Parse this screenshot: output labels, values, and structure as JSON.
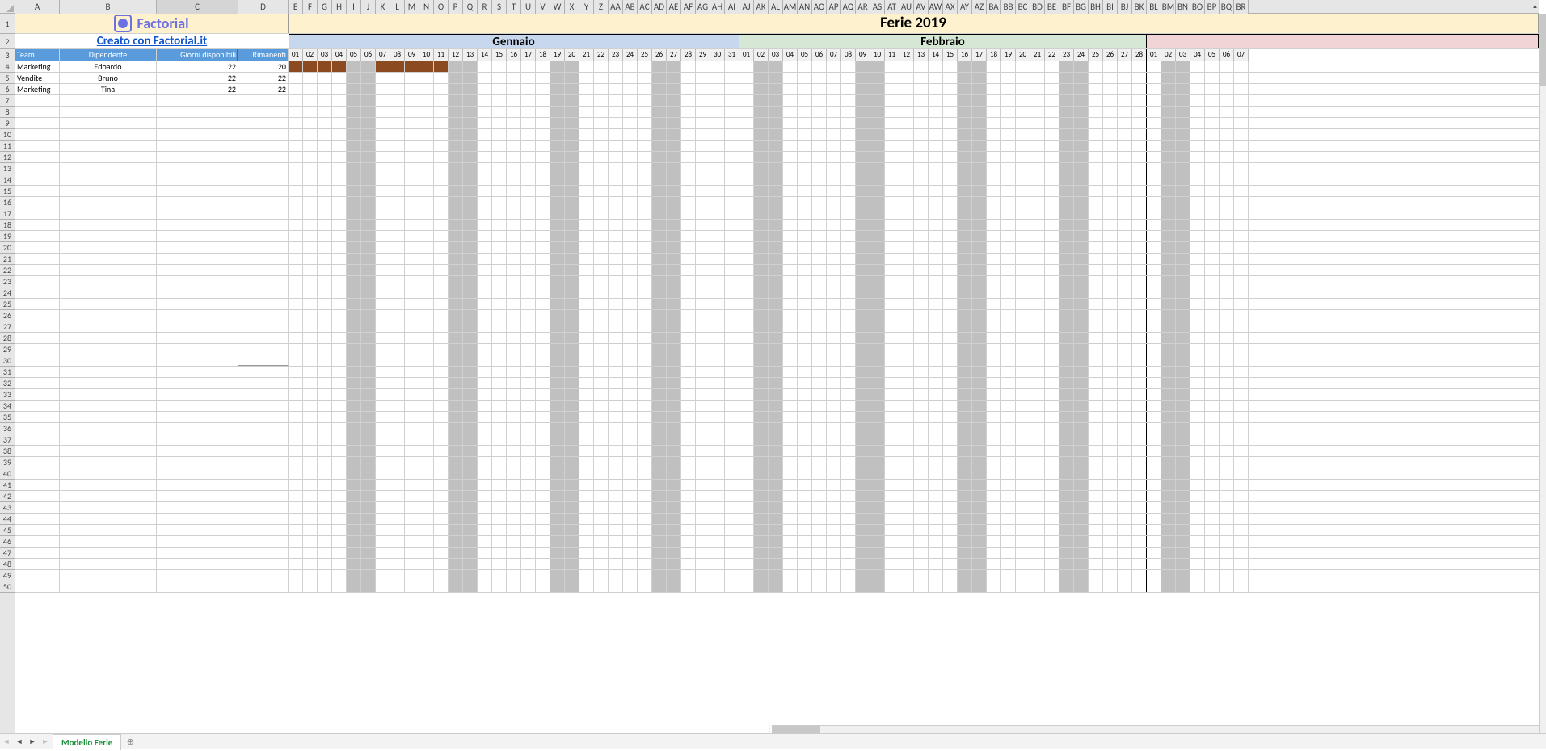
{
  "title": "Ferie 2019",
  "logo_text": "Factorial",
  "link_text": "Creato con Factorial.it",
  "months": {
    "jan": "Gennaio",
    "feb": "Febbraio"
  },
  "headers": {
    "team": "Team",
    "dip": "Dipendente",
    "disp": "Giorni disponibili",
    "rim": "Rimanenti"
  },
  "employees": [
    {
      "team": "Marketing",
      "name": "Edoardo",
      "disp": "22",
      "rim": "20"
    },
    {
      "team": "Vendite",
      "name": "Bruno",
      "disp": "22",
      "rim": "22"
    },
    {
      "team": "Marketing",
      "name": "Tina",
      "disp": "22",
      "rim": "22"
    }
  ],
  "columns": [
    "A",
    "B",
    "C",
    "D",
    "E",
    "F",
    "G",
    "H",
    "I",
    "J",
    "K",
    "L",
    "M",
    "N",
    "O",
    "P",
    "Q",
    "R",
    "S",
    "T",
    "U",
    "V",
    "W",
    "X",
    "Y",
    "Z",
    "AA",
    "AB",
    "AC",
    "AD",
    "AE",
    "AF",
    "AG",
    "AH",
    "AI",
    "AJ",
    "AK",
    "AL",
    "AM",
    "AN",
    "AO",
    "AP",
    "AQ",
    "AR",
    "AS",
    "AT",
    "AU",
    "AV",
    "AW",
    "AX",
    "AY",
    "AZ",
    "BA",
    "BB",
    "BC",
    "BD",
    "BE",
    "BF",
    "BG",
    "BH",
    "BI",
    "BJ",
    "BK",
    "BL",
    "BM",
    "BN",
    "BO",
    "BP",
    "BQ",
    "BR"
  ],
  "jan_days": [
    "01",
    "02",
    "03",
    "04",
    "05",
    "06",
    "07",
    "08",
    "09",
    "10",
    "11",
    "12",
    "13",
    "14",
    "15",
    "16",
    "17",
    "18",
    "19",
    "20",
    "21",
    "22",
    "23",
    "24",
    "25",
    "26",
    "27",
    "28",
    "29",
    "30",
    "31"
  ],
  "feb_days": [
    "01",
    "02",
    "03",
    "04",
    "05",
    "06",
    "07",
    "08",
    "09",
    "10",
    "11",
    "12",
    "13",
    "14",
    "15",
    "16",
    "17",
    "18",
    "19",
    "20",
    "21",
    "22",
    "23",
    "24",
    "25",
    "26",
    "27",
    "28"
  ],
  "mar_days": [
    "01",
    "02",
    "03",
    "04",
    "05",
    "06",
    "07"
  ],
  "jan_wkend": [
    5,
    6,
    12,
    13,
    19,
    20,
    26,
    27
  ],
  "feb_wkend": [
    2,
    3,
    9,
    10,
    16,
    17,
    23,
    24
  ],
  "mar_wkend": [
    2,
    3
  ],
  "ferie_edo": [
    1,
    2,
    3,
    4,
    7,
    8,
    9,
    10,
    11
  ],
  "tab_name": "Modello Ferie",
  "row_count": 50,
  "selected_col": "C"
}
